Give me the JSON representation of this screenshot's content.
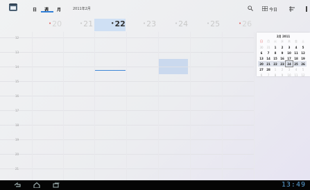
{
  "action_bar": {
    "tabs": [
      {
        "label": "日"
      },
      {
        "label": "週"
      },
      {
        "label": "月"
      }
    ],
    "month_label": "2011年2月",
    "today_button": "今日",
    "icons": [
      "calendar-app-icon",
      "search-icon",
      "grid-icon",
      "tasks-icon",
      "menu-icon"
    ]
  },
  "day_headers": [
    {
      "day": "20",
      "weekend": true
    },
    {
      "day": "21",
      "weekend": false
    },
    {
      "day": "22",
      "weekend": false,
      "today": true
    },
    {
      "day": "23",
      "weekend": false
    },
    {
      "day": "24",
      "weekend": false
    },
    {
      "day": "25",
      "weekend": false
    },
    {
      "day": "26",
      "weekend": true
    }
  ],
  "hours": [
    "12",
    "13",
    "14",
    "15",
    "16",
    "17",
    "18",
    "19",
    "20",
    "21"
  ],
  "mini_calendar": {
    "title": "2月 2011",
    "weekdays": [
      "日",
      "月",
      "火",
      "水",
      "木",
      "金",
      "土"
    ],
    "weeks": [
      [
        "30",
        "31",
        "1",
        "2",
        "3",
        "4",
        "5"
      ],
      [
        "6",
        "7",
        "8",
        "9",
        "10",
        "11",
        "12"
      ],
      [
        "13",
        "14",
        "15",
        "16",
        "17",
        "18",
        "19"
      ],
      [
        "20",
        "21",
        "22",
        "23",
        "24",
        "25",
        "26"
      ],
      [
        "27",
        "28",
        "1",
        "2",
        "3",
        "4",
        "5"
      ],
      [
        "6",
        "7",
        "8",
        "9",
        "10",
        "11",
        "12"
      ]
    ],
    "selected": "24"
  },
  "system_bar": {
    "clock": "13:49",
    "nav": [
      "back-icon",
      "home-icon",
      "recent-apps-icon"
    ]
  },
  "colors": {
    "accent": "#2f7fd8",
    "today_highlight": "#cfe0f4",
    "weekend": "#e06060",
    "clock": "#5a9fd4"
  }
}
